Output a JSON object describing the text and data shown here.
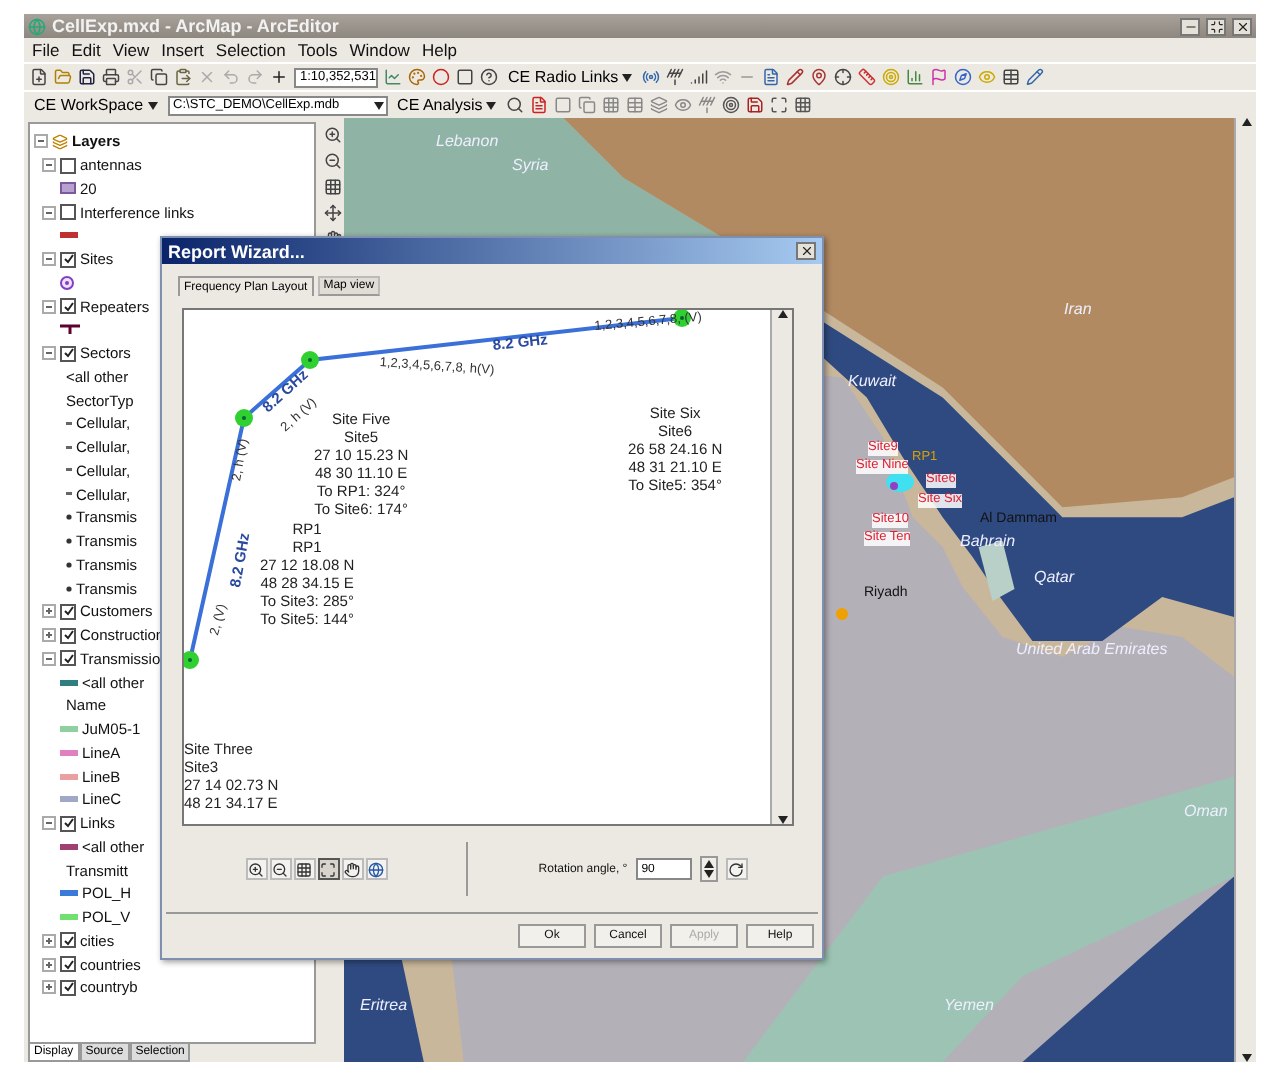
{
  "window": {
    "title": "CellExp.mxd - ArcMap - ArcEditor"
  },
  "menu": [
    "File",
    "Edit",
    "View",
    "Insert",
    "Selection",
    "Tools",
    "Window",
    "Help"
  ],
  "toolbar": {
    "scale": "1:10,352,531",
    "radio_links": "CE Radio Links",
    "workspace_label": "CE WorkSpace",
    "workspace_path": "C:\\STC_DEMO\\CellExp.mdb",
    "analysis": "CE Analysis"
  },
  "toc": {
    "root": "Layers",
    "root_expanded": true,
    "layers": [
      {
        "name": "antennas",
        "checked": false,
        "expanded": true,
        "legend": [
          {
            "label": "20",
            "kind": "square"
          }
        ]
      },
      {
        "name": "Interference links",
        "checked": false,
        "expanded": true,
        "legend": [
          {
            "kind": "line",
            "color": "#c03030"
          }
        ]
      },
      {
        "name": "Sites",
        "checked": true,
        "expanded": true,
        "legend": [
          {
            "kind": "circle"
          }
        ]
      },
      {
        "name": "Repeaters",
        "checked": true,
        "expanded": true,
        "legend": [
          {
            "kind": "repeater"
          }
        ]
      },
      {
        "name": "Sectors",
        "checked": true,
        "expanded": true,
        "legend": [
          {
            "label": "<all other",
            "kind": "none"
          },
          {
            "label": "SectorTyp",
            "kind": "none"
          },
          {
            "label": "Cellular,",
            "kind": "dash"
          },
          {
            "label": "Cellular,",
            "kind": "dash"
          },
          {
            "label": "Cellular,",
            "kind": "dash"
          },
          {
            "label": "Cellular,",
            "kind": "dash"
          },
          {
            "label": "Transmis",
            "kind": "dot"
          },
          {
            "label": "Transmis",
            "kind": "dot"
          },
          {
            "label": "Transmis",
            "kind": "dot"
          },
          {
            "label": "Transmis",
            "kind": "dot"
          }
        ]
      },
      {
        "name": "Customers",
        "checked": true,
        "expanded": false
      },
      {
        "name": "Construction",
        "checked": true,
        "expanded": false
      },
      {
        "name": "Transmissio",
        "checked": true,
        "expanded": true,
        "legend": [
          {
            "label": "<all other",
            "kind": "line",
            "color": "#2f7f80"
          },
          {
            "label": "Name",
            "kind": "none"
          },
          {
            "label": "JuM05-1",
            "kind": "line",
            "color": "#8fd0a0"
          },
          {
            "label": "LineA",
            "kind": "line",
            "color": "#e080c0"
          },
          {
            "label": "LineB",
            "kind": "line",
            "color": "#e8a0a0"
          },
          {
            "label": "LineC",
            "kind": "line",
            "color": "#a0a8c8"
          }
        ]
      },
      {
        "name": "Links",
        "checked": true,
        "expanded": true,
        "legend": [
          {
            "label": "<all other",
            "kind": "line",
            "color": "#a04070"
          },
          {
            "label": "Transmitt",
            "kind": "none"
          },
          {
            "label": "POL_H",
            "kind": "line",
            "color": "#3a7ad8"
          },
          {
            "label": "POL_V",
            "kind": "line",
            "color": "#70e070"
          }
        ]
      },
      {
        "name": "cities",
        "checked": true,
        "expanded": false
      },
      {
        "name": "countries",
        "checked": true,
        "expanded": false
      },
      {
        "name": "countryb",
        "checked": true,
        "expanded": false
      }
    ],
    "tabs": [
      {
        "label": "Display",
        "selected": true
      },
      {
        "label": "Source",
        "selected": false
      },
      {
        "label": "Selection",
        "selected": false
      }
    ]
  },
  "map": {
    "labels": [
      {
        "text": "Lebanon",
        "kind": "country"
      },
      {
        "text": "Syria",
        "kind": "country"
      },
      {
        "text": "Iran",
        "kind": "country"
      },
      {
        "text": "Kuwait",
        "kind": "country"
      },
      {
        "text": "Al Dammam",
        "kind": "city"
      },
      {
        "text": "Bahrain",
        "kind": "country"
      },
      {
        "text": "Qatar",
        "kind": "country"
      },
      {
        "text": "Riyadh",
        "kind": "city"
      },
      {
        "text": "United Arab Emirates",
        "kind": "country"
      },
      {
        "text": "Oman",
        "kind": "country"
      },
      {
        "text": "Eritrea",
        "kind": "country"
      },
      {
        "text": "Yemen",
        "kind": "country"
      },
      {
        "text": "Site9",
        "kind": "site"
      },
      {
        "text": "Site Nine",
        "kind": "site"
      },
      {
        "text": "RP1",
        "kind": "repeater"
      },
      {
        "text": "Site6",
        "kind": "site"
      },
      {
        "text": "Site Six",
        "kind": "site"
      },
      {
        "text": "Site10",
        "kind": "site"
      },
      {
        "text": "Site Ten",
        "kind": "site"
      }
    ]
  },
  "dialog": {
    "title": "Report Wizard...",
    "tabs": [
      {
        "label": "Frequency Plan Layout",
        "selected": true
      },
      {
        "label": "Map view",
        "selected": false
      }
    ],
    "sites": [
      {
        "lines": [
          "Site Five",
          "Site5",
          "27 10 15.23 N",
          "48 30 11.10 E",
          "To RP1: 324°",
          "To Site6: 174°"
        ]
      },
      {
        "lines": [
          "Site Six",
          "Site6",
          "26 58 24.16 N",
          "48 31 21.10 E",
          "To Site5: 354°"
        ]
      },
      {
        "lines": [
          "RP1",
          "RP1",
          "27 12 18.08 N",
          "48 28 34.15 E",
          "To Site3: 285°",
          "To Site5: 144°"
        ]
      },
      {
        "lines": [
          "Site Three",
          "Site3",
          "27 14 02.73 N",
          "48 21 34.17 E"
        ]
      }
    ],
    "link_labels": [
      "8.2 GHz",
      "1,2,3,4,5,6,7,8, (V)",
      "1,2,3,4,5,6,7,8, h(V)",
      "8.2 GHz",
      "2, h (V)",
      "2, h (V)",
      "8.2 GHz",
      "2, (V)"
    ],
    "rotation": {
      "label": "Rotation angle, °",
      "value": "90"
    },
    "buttons": [
      {
        "label": "Ok",
        "disabled": false
      },
      {
        "label": "Cancel",
        "disabled": false
      },
      {
        "label": "Apply",
        "disabled": true
      },
      {
        "label": "Help",
        "disabled": false
      }
    ]
  }
}
